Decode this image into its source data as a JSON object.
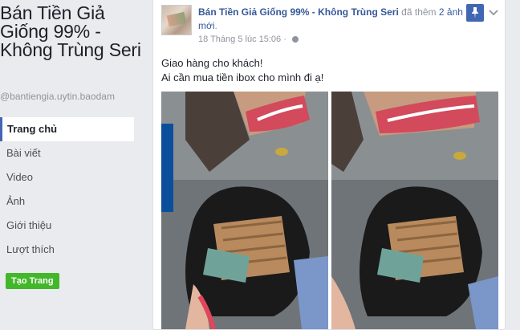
{
  "sidebar": {
    "page_name": "Bán Tiền Giả Giống 99% - Không Trùng Seri",
    "handle": "@bantiengia.uytin.baodam",
    "nav": [
      {
        "label": "Trang chủ",
        "active": true
      },
      {
        "label": "Bài viết",
        "active": false
      },
      {
        "label": "Video",
        "active": false
      },
      {
        "label": "Ảnh",
        "active": false
      },
      {
        "label": "Giới thiệu",
        "active": false
      },
      {
        "label": "Lượt thích",
        "active": false
      }
    ],
    "create_button": "Tạo Trang"
  },
  "post": {
    "author": "Bán Tiền Giả Giống 99% - Không Trùng Seri",
    "action_prefix": "đã",
    "action_text": "thêm",
    "action_link": "2 ảnh mới",
    "timestamp": "18 Tháng 5 lúc 15:06",
    "privacy_icon": "globe-icon",
    "text_line_1": "Giao hàng cho khách!",
    "text_line_2": "Ai cần mua tiền ibox cho mình đi ạ!",
    "photo_count": 2
  },
  "colors": {
    "accent": "#4267b2",
    "link": "#365899",
    "create_button": "#42b72a",
    "background": "#e9ebee"
  }
}
